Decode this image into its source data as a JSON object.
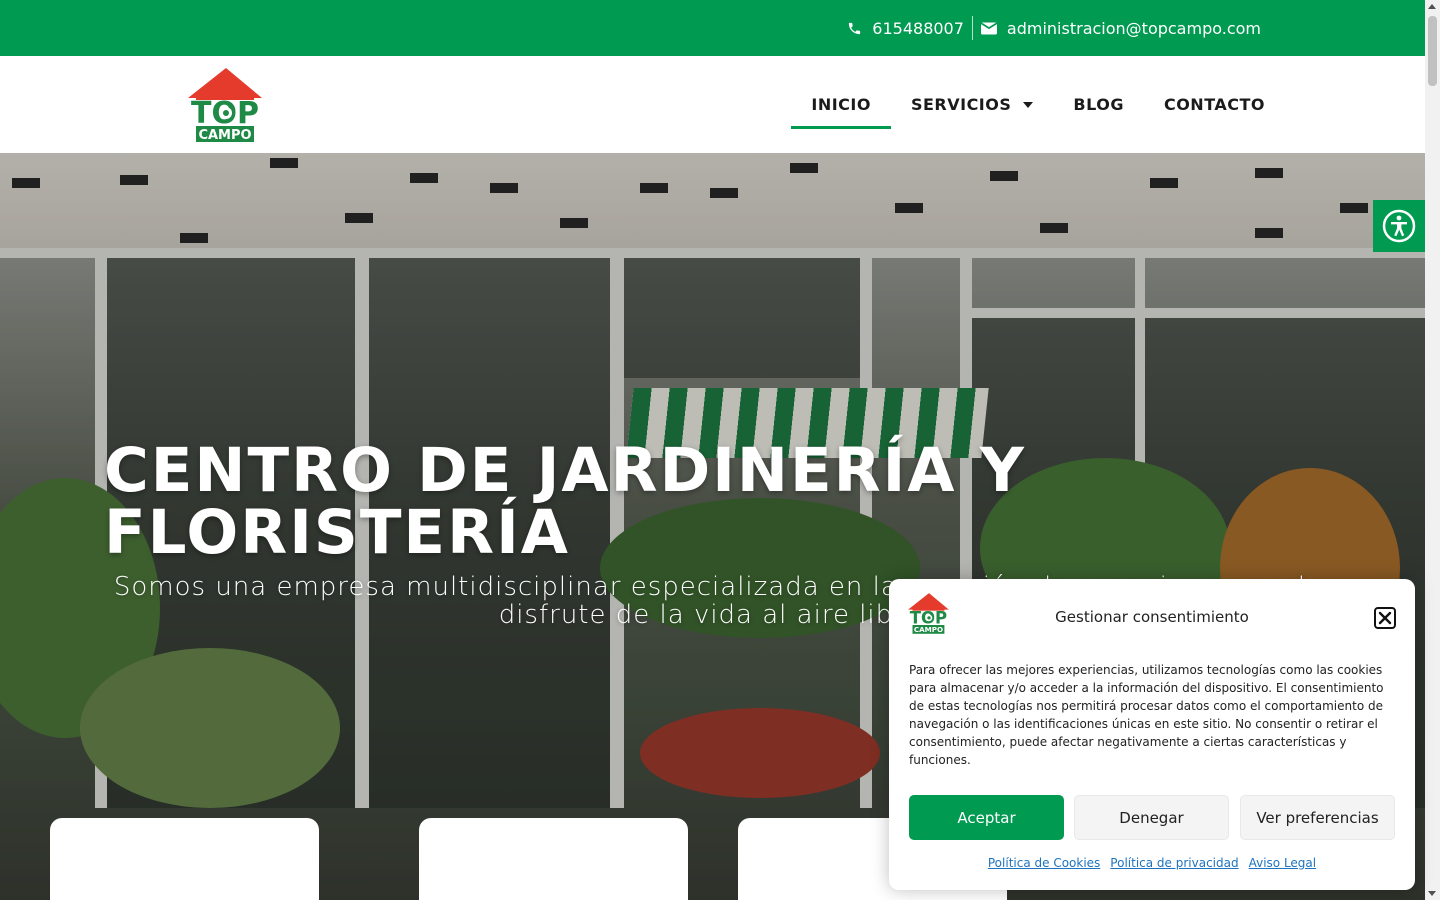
{
  "topbar": {
    "phone": "615488007",
    "email": "administracion@topcampo.com"
  },
  "logo": {
    "brand_top": "TOP",
    "brand_bottom": "CAMPO"
  },
  "nav": {
    "items": [
      {
        "label": "INICIO",
        "active": true
      },
      {
        "label": "SERVICIOS",
        "has_dropdown": true
      },
      {
        "label": "BLOG"
      },
      {
        "label": "CONTACTO"
      }
    ]
  },
  "hero": {
    "title": "CENTRO DE JARDINERÍA Y FLORISTERÍA",
    "subtitle": "Somos una empresa multidisciplinar especializada en la creación de espacios para el disfrute de la vida al aire libre"
  },
  "consent": {
    "title": "Gestionar consentimiento",
    "text": "Para ofrecer las mejores experiencias, utilizamos tecnologías como las cookies para almacenar y/o acceder a la información del dispositivo. El consentimiento de estas tecnologías nos permitirá procesar datos como el comportamiento de navegación o las identificaciones únicas en este sitio. No consentir o retirar el consentimiento, puede afectar negativamente a ciertas características y funciones.",
    "accept": "Aceptar",
    "deny": "Denegar",
    "preferences": "Ver preferencias",
    "links": [
      "Política de Cookies",
      "Política de privacidad",
      "Aviso Legal"
    ]
  },
  "colors": {
    "brand_green": "#009a51",
    "logo_red": "#e53b2c"
  },
  "icons": [
    "phone-icon",
    "envelope-icon",
    "chevron-down-icon",
    "accessibility-icon",
    "close-icon"
  ]
}
